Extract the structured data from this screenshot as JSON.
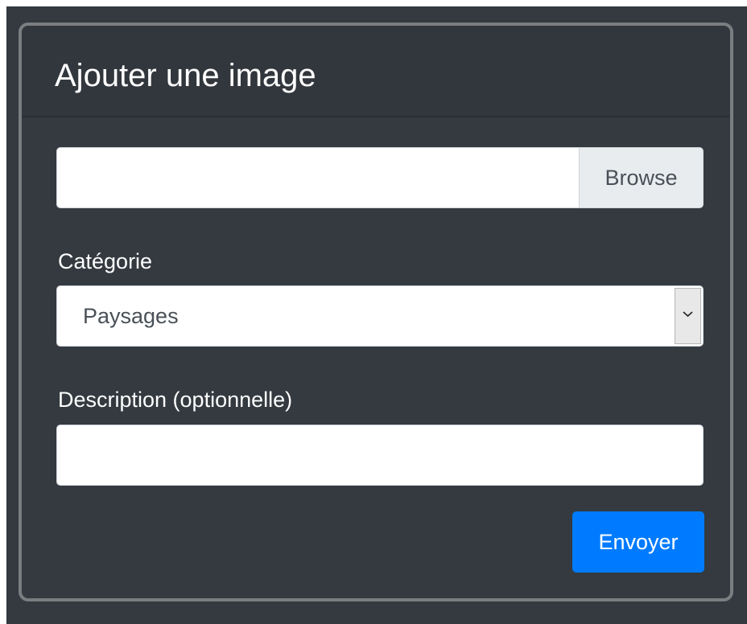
{
  "card": {
    "title": "Ajouter une image"
  },
  "file_upload": {
    "value": "",
    "browse_label": "Browse"
  },
  "category": {
    "label": "Catégorie",
    "selected_value": "Paysages",
    "icon": "chevron-down-icon"
  },
  "description": {
    "label": "Description (optionnelle)",
    "value": ""
  },
  "submit": {
    "label": "Envoyer"
  },
  "colors": {
    "background": "#343a40",
    "card_border": "#7b7e81",
    "header_background": "#32373d",
    "text_light": "#ffffff",
    "input_background": "#ffffff",
    "input_border": "#ced4da",
    "browse_background": "#e9ecef",
    "primary": "#007bff"
  }
}
